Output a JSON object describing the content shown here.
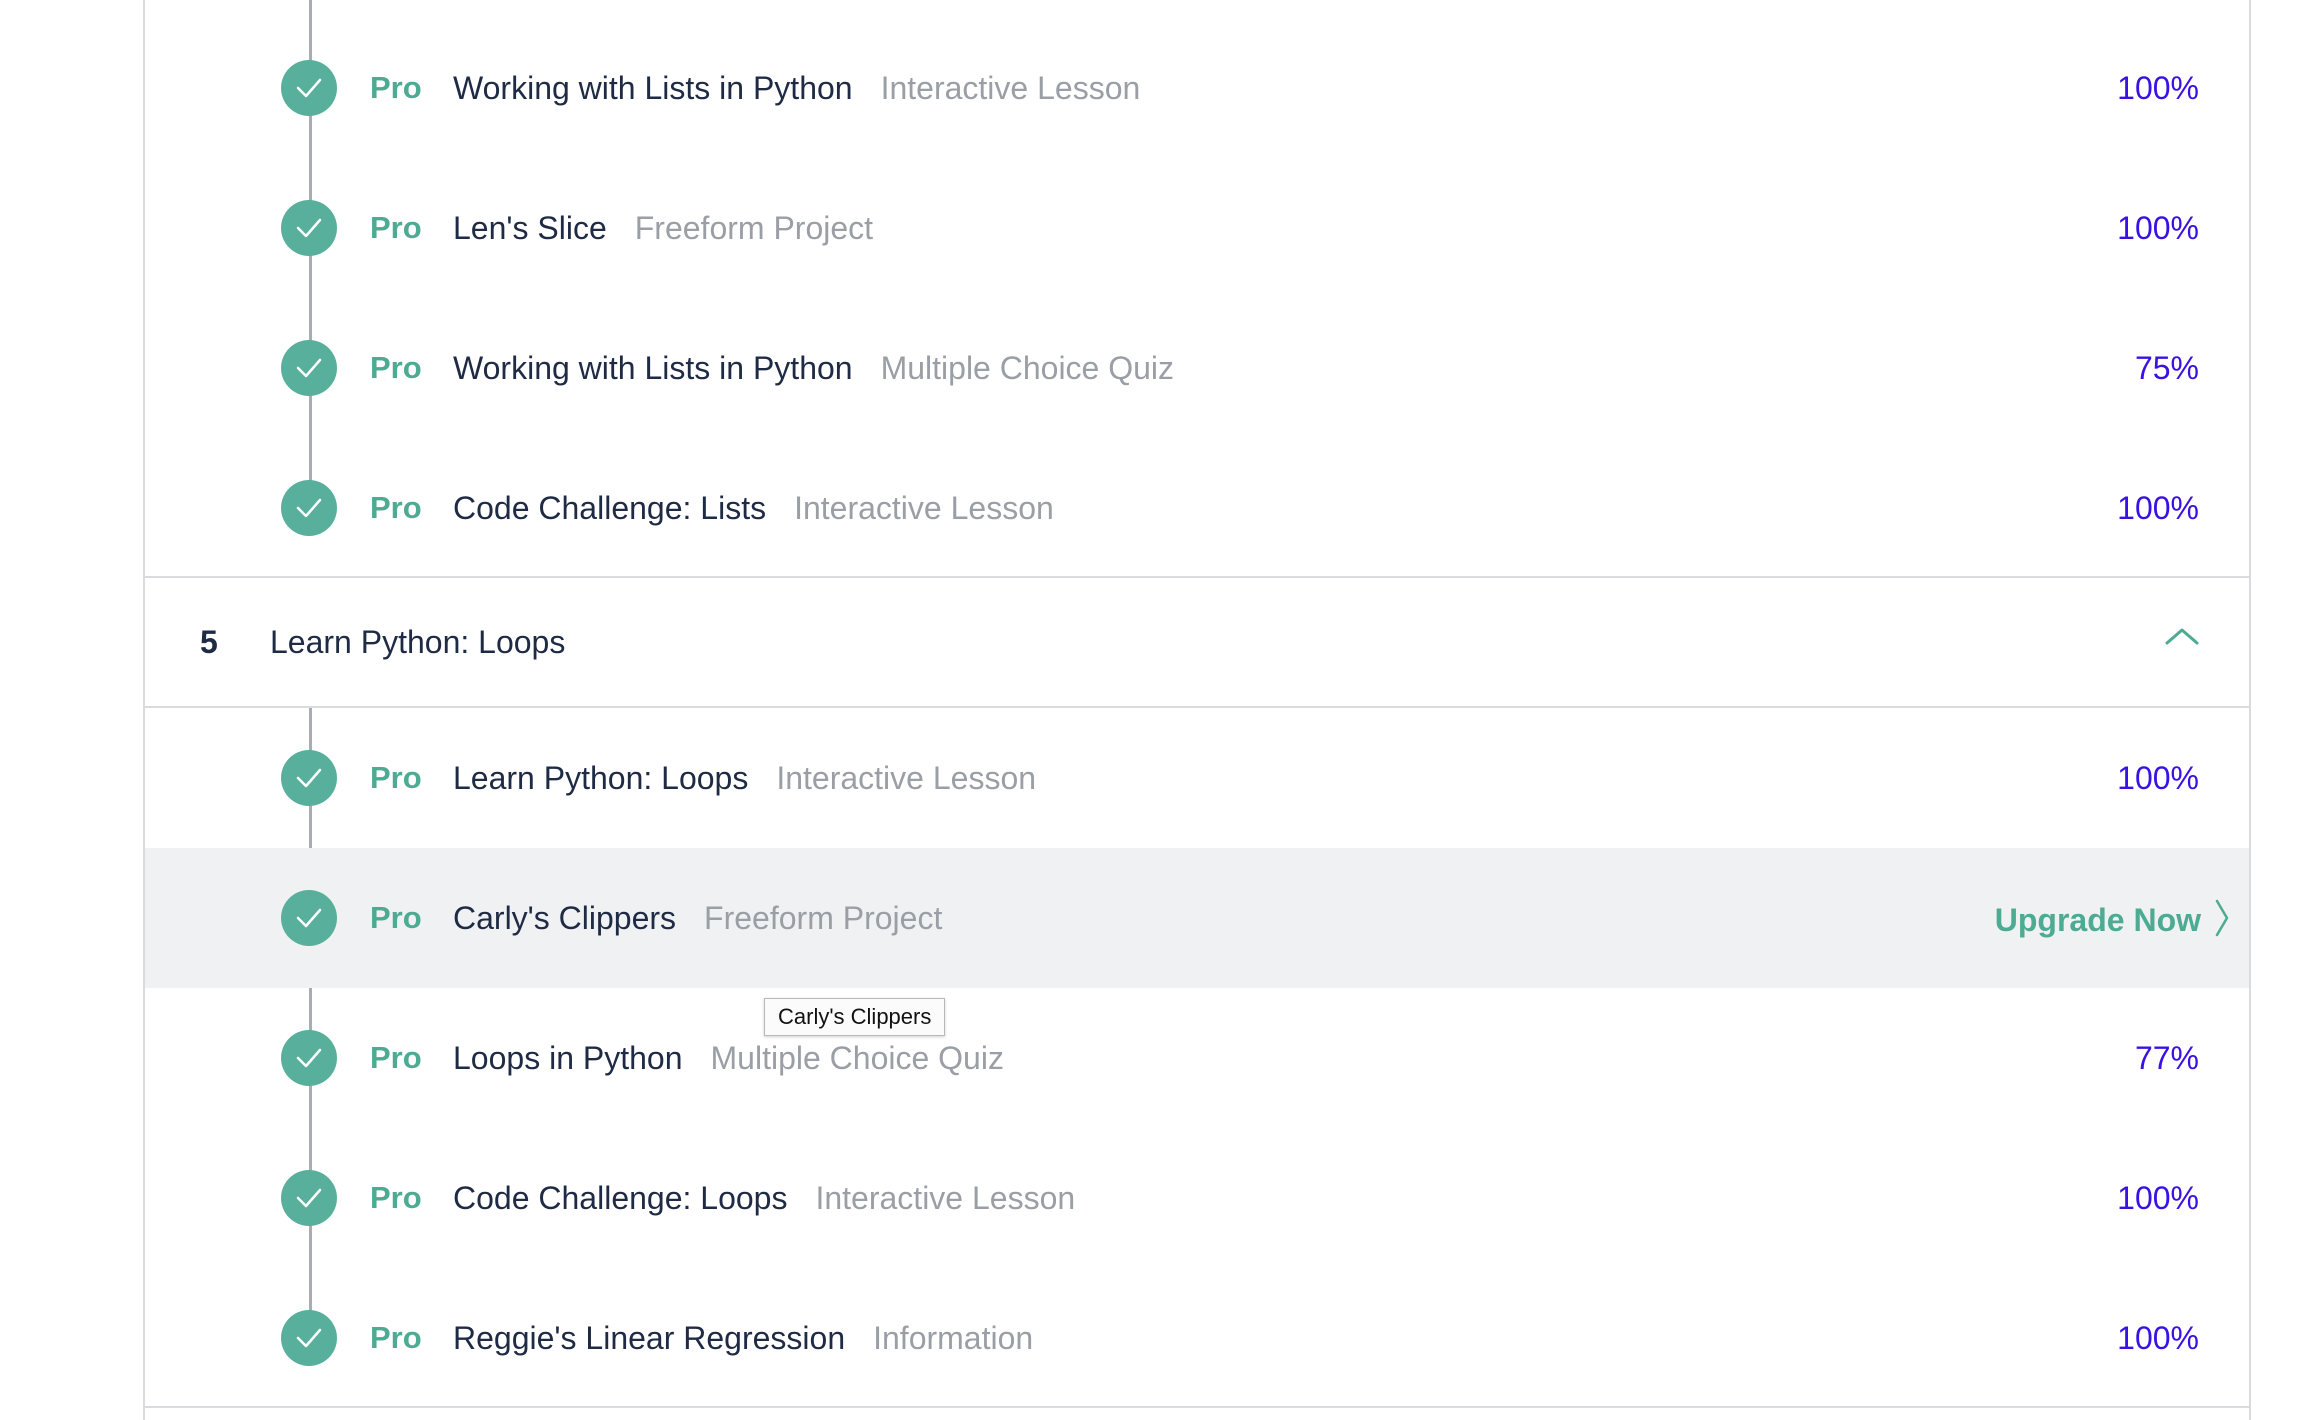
{
  "group_a": {
    "items": [
      {
        "badge": "Pro",
        "title": "Working with Lists in Python",
        "kind": "Interactive Lesson",
        "progress": "100%"
      },
      {
        "badge": "Pro",
        "title": "Len's Slice",
        "kind": "Freeform Project",
        "progress": "100%"
      },
      {
        "badge": "Pro",
        "title": "Working with Lists in Python",
        "kind": "Multiple Choice Quiz",
        "progress": "75%"
      },
      {
        "badge": "Pro",
        "title": "Code Challenge: Lists",
        "kind": "Interactive Lesson",
        "progress": "100%"
      }
    ]
  },
  "section_5": {
    "number": "5",
    "title": "Learn Python: Loops",
    "items": [
      {
        "badge": "Pro",
        "title": "Learn Python: Loops",
        "kind": "Interactive Lesson",
        "progress": "100%"
      },
      {
        "badge": "Pro",
        "title": "Carly's Clippers",
        "kind": "Freeform Project",
        "action": "Upgrade Now"
      },
      {
        "badge": "Pro",
        "title": "Loops in Python",
        "kind": "Multiple Choice Quiz",
        "progress": "77%"
      },
      {
        "badge": "Pro",
        "title": "Code Challenge: Loops",
        "kind": "Interactive Lesson",
        "progress": "100%"
      },
      {
        "badge": "Pro",
        "title": "Reggie's Linear Regression",
        "kind": "Information",
        "progress": "100%"
      }
    ]
  },
  "tooltip": {
    "text": "Carly's Clippers"
  },
  "colors": {
    "accent_green": "#4daa93",
    "check_green": "#58b09c",
    "progress_blue": "#3a10e5",
    "title_text": "#1f2a44",
    "kind_text": "#9a9ea5",
    "hover_row": "#f0f1f2"
  },
  "icons": {
    "completed": "check-circle-icon",
    "collapse": "chevron-up-icon",
    "action": "chevron-right-icon"
  }
}
